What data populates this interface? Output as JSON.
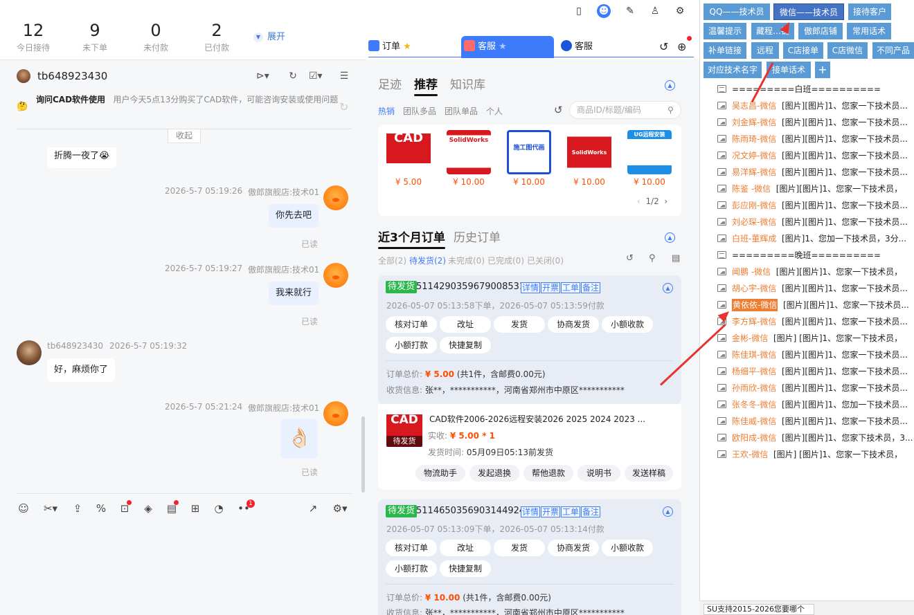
{
  "stats": [
    {
      "value": "12",
      "label": "今日接待"
    },
    {
      "value": "9",
      "label": "未下单"
    },
    {
      "value": "0",
      "label": "未付款"
    },
    {
      "value": "2",
      "label": "已付款"
    }
  ],
  "expand_label": "展开",
  "chat": {
    "customer_name": "tb648923430",
    "intent_title": "询问CAD软件使用",
    "intent_text": "用户今天5点13分购买了CAD软件，可能咨询安装或使用问题",
    "intent_emoji": "🤔",
    "collapse_label": "收起",
    "messages": [
      {
        "text": "折腾一夜了😭"
      },
      {
        "time": "2026-5-7 05:19:26",
        "sender": "傲郎旗舰店:技术01",
        "text": "你先去吧",
        "status": "已读"
      },
      {
        "time": "2026-5-7 05:19:27",
        "sender": "傲郎旗舰店:技术01",
        "text": "我来就行",
        "status": "已读"
      },
      {
        "sender": "tb648923430",
        "time": "2026-5-7 05:19:32",
        "text": "好，麻烦你了"
      },
      {
        "time": "2026-5-7 05:21:24",
        "sender": "傲郎旗舰店:技术01",
        "text": "👌🏻",
        "status": "已读"
      }
    ],
    "badge_count": "1"
  },
  "tabs": [
    {
      "label": "订单"
    },
    {
      "label": "客服"
    },
    {
      "label": "客服"
    }
  ],
  "rec": {
    "tabs": [
      "足迹",
      "推荐",
      "知识库"
    ],
    "subtabs": [
      "热销",
      "团队多品",
      "团队单品",
      "个人"
    ],
    "search_placeholder": "商品ID/标题/编码",
    "products": [
      {
        "title": "CAD",
        "price": "¥ 5.00"
      },
      {
        "title": "SolidWorks",
        "price": "¥ 10.00"
      },
      {
        "title": "施工图代画",
        "price": "¥ 10.00"
      },
      {
        "title": "SolidWorks",
        "price": "¥ 10.00"
      },
      {
        "title": "UG远程安装",
        "price": "¥ 10.00"
      }
    ],
    "pager": "1/2"
  },
  "orders_section": {
    "tabs": [
      "近3个月订单",
      "历史订单"
    ],
    "filters": [
      "全部(2)",
      "待发货(2)",
      "未完成(0)",
      "已完成(0)",
      "已关闭(0)"
    ]
  },
  "orders": [
    {
      "status": "待发货",
      "number": "5114290359679008531",
      "links": [
        "详情",
        "开票",
        "工单",
        "备注"
      ],
      "time": "2026-05-07 05:13:58下单，2026-05-07 05:13:59付款",
      "buttons": [
        "核对订单",
        "改址",
        "发货",
        "协商发货",
        "小额收款",
        "小额打款",
        "快捷复制"
      ],
      "total_label": "订单总价:",
      "total": "¥ 5.00",
      "total_note": "(共1件，含邮费0.00元)",
      "address_label": "收货信息:",
      "address": "张**，***********，河南省郑州市中原区***********",
      "item_title": "CAD软件2006-2026远程安装2026 2025 2024 2023 ...",
      "item_paid_label": "实收:",
      "item_paid": "¥ 5.00 * 1",
      "item_ship_label": "发货时间:",
      "item_ship": "05月09日05:13前发货",
      "item_badge": "待发货",
      "item_buttons": [
        "物流助手",
        "发起退换",
        "帮他退款",
        "说明书",
        "发送样稿"
      ]
    },
    {
      "status": "待发货",
      "number": "5114650356903144924",
      "links": [
        "详情",
        "开票",
        "工单",
        "备注"
      ],
      "time": "2026-05-07 05:13:09下单，2026-05-07 05:13:14付款",
      "buttons": [
        "核对订单",
        "改址",
        "发货",
        "协商发货",
        "小额收款",
        "小额打款",
        "快捷复制"
      ],
      "total_label": "订单总价:",
      "total": "¥ 10.00",
      "total_note": "(共1件，含邮费0.00元)",
      "address_label": "收货信息:",
      "address": "张**，***********，河南省郑州市中原区***********"
    }
  ],
  "quick_buttons": [
    "QQ——技术员",
    "微信——技术员",
    "接待客户",
    "温馨提示",
    "藏程…铺",
    "傲郎店铺",
    "常用话术",
    "补单链接",
    "远程",
    "C店接单",
    "C店微信",
    "不同产品",
    "对应技术名字",
    "接单话术",
    "+"
  ],
  "tree": [
    {
      "type": "doc",
      "text": "=========白班=========="
    },
    {
      "type": "img",
      "name": "吴志昌-微信",
      "text": "[图片][图片]1、您家一下技术员..."
    },
    {
      "type": "img",
      "name": "刘金辉-微信",
      "text": "[图片][图片]1、您家一下技术员..."
    },
    {
      "type": "img",
      "name": "陈雨琦-微信",
      "text": "[图片][图片]1、您家一下技术员..."
    },
    {
      "type": "img",
      "name": "况文婷-微信",
      "text": "[图片][图片]1、您家一下技术员..."
    },
    {
      "type": "img",
      "name": "易洋辉-微信",
      "text": "[图片][图片]1、您家一下技术员..."
    },
    {
      "type": "img",
      "name": "陈鉴 -微信",
      "text": "[图片][图片]1、您家一下技术员，"
    },
    {
      "type": "img",
      "name": "彭应刚-微信",
      "text": "[图片][图片]1、您家一下技术员..."
    },
    {
      "type": "img",
      "name": "刘必琛-微信",
      "text": "[图片][图片]1、您家一下技术员..."
    },
    {
      "type": "img",
      "name": "白班-董辉成",
      "text": "[图片]1、您加一下技术员，3分..."
    },
    {
      "type": "doc",
      "text": "=========晚班=========="
    },
    {
      "type": "img",
      "name": "闻鹏 -微信",
      "text": "[图片][图片]1、您家一下技术员，"
    },
    {
      "type": "img",
      "name": "胡心宇-微信",
      "text": "[图片][图片]1、您家一下技术员..."
    },
    {
      "type": "img",
      "name": "黄依依-微信",
      "text": "[图片][图片]1、您家一下技术员...",
      "selected": true
    },
    {
      "type": "img",
      "name": "李方辉-微信",
      "text": "[图片][图片]1、您家一下技术员..."
    },
    {
      "type": "img",
      "name": "金彬-微信",
      "text": "[图片] [图片]1、您家一下技术员，"
    },
    {
      "type": "img",
      "name": "陈佳琪-微信",
      "text": "[图片][图片]1、您家一下技术员..."
    },
    {
      "type": "img",
      "name": "杨细平-微信",
      "text": "[图片][图片]1、您家一下技术员..."
    },
    {
      "type": "img",
      "name": "孙雨欣-微信",
      "text": "[图片][图片]1、您家一下技术员..."
    },
    {
      "type": "img",
      "name": "张冬冬-微信",
      "text": "[图片][图片]1、您加一下技术员..."
    },
    {
      "type": "img",
      "name": "陈佳威-微信",
      "text": "[图片][图片]1、您家一下技术员..."
    },
    {
      "type": "img",
      "name": "欧阳成-微信",
      "text": "[图片][图片]1、您家下技术员，3..."
    },
    {
      "type": "img",
      "name": "王欢-微信",
      "text": "[图片] [图片]1、您家一下技术员，"
    }
  ],
  "status_text": "SU支持2015-2026您要哪个",
  "colors": {
    "accent": "#3e7bfa",
    "price": "#ff4f00",
    "badge_green": "#2bb84a",
    "quick_button": "#5b9bd5",
    "tree_name": "#ed7d31",
    "arrow": "#e8322d"
  }
}
